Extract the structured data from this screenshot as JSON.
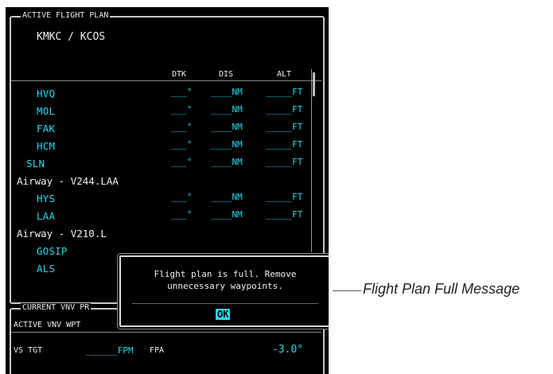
{
  "flight_plan": {
    "title": "ACTIVE FLIGHT PLAN",
    "route": "KMKC / KCOS",
    "headers": {
      "dtk": "DTK",
      "dis": "DIS",
      "alt": "ALT"
    },
    "rows": [
      {
        "name": "HVQ",
        "dtk": "___°",
        "dis": "____NM",
        "alt": "_____FT"
      },
      {
        "name": "MOL",
        "dtk": "___°",
        "dis": "____NM",
        "alt": "_____FT"
      },
      {
        "name": "FAK",
        "dtk": "___°",
        "dis": "____NM",
        "alt": "_____FT"
      },
      {
        "name": "HCM",
        "dtk": "___°",
        "dis": "____NM",
        "alt": "_____FT"
      },
      {
        "name": "SLN",
        "dtk": "___°",
        "dis": "____NM",
        "alt": "_____FT"
      },
      {
        "airway": "Airway - V244.LAA"
      },
      {
        "name": "HYS",
        "dtk": "___°",
        "dis": "____NM",
        "alt": "_____FT"
      },
      {
        "name": "LAA",
        "dtk": "___°",
        "dis": "____NM",
        "alt": "_____FT"
      },
      {
        "airway": "Airway - V210.L"
      },
      {
        "name": "GOSIP"
      },
      {
        "name": "ALS"
      }
    ]
  },
  "vnv": {
    "title": "CURRENT VNV PR",
    "active_wpt_label": "ACTIVE VNV WPT",
    "vs_tgt_label": "VS TGT",
    "vs_tgt_value": "______FPM",
    "fpa_label": "FPA",
    "fpa_value": "-3.0°"
  },
  "popup": {
    "message": "Flight plan is full. Remove\nunnecessary waypoints.",
    "ok_label": "OK"
  },
  "callout": {
    "label": "Flight Plan Full Message"
  },
  "colors": {
    "cyan": "#2ad8ee",
    "background": "#000000",
    "text": "#f0f0f0"
  }
}
